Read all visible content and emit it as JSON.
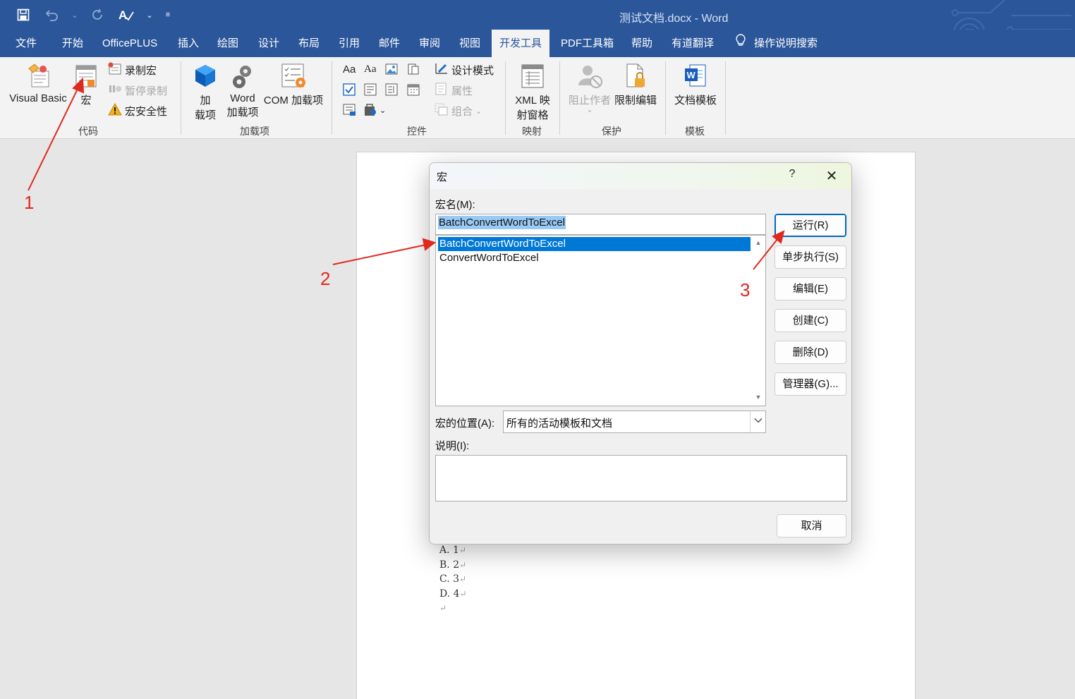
{
  "window": {
    "title": "测试文档.docx  -  Word"
  },
  "qat": {
    "icons": [
      "save-icon",
      "undo-icon",
      "redo-icon",
      "spellcheck-icon",
      "customize-icon"
    ]
  },
  "tabs": [
    {
      "label": "文件",
      "active": false
    },
    {
      "label": "开始",
      "active": false
    },
    {
      "label": "OfficePLUS",
      "active": false
    },
    {
      "label": "插入",
      "active": false
    },
    {
      "label": "绘图",
      "active": false
    },
    {
      "label": "设计",
      "active": false
    },
    {
      "label": "布局",
      "active": false
    },
    {
      "label": "引用",
      "active": false
    },
    {
      "label": "邮件",
      "active": false
    },
    {
      "label": "审阅",
      "active": false
    },
    {
      "label": "视图",
      "active": false
    },
    {
      "label": "开发工具",
      "active": true
    },
    {
      "label": "PDF工具箱",
      "active": false
    },
    {
      "label": "帮助",
      "active": false
    },
    {
      "label": "有道翻译",
      "active": false
    },
    {
      "label": "操作说明搜索",
      "active": false
    }
  ],
  "ribbon": {
    "code": {
      "label": "代码",
      "visual_basic": "Visual Basic",
      "macros": "宏",
      "record_macro": "录制宏",
      "pause_recording": "暂停录制",
      "macro_security": "宏安全性"
    },
    "addins": {
      "label": "加载项",
      "addins_line1": "加",
      "addins_line2": "载项",
      "word_addins_line1": "Word",
      "word_addins_line2": "加载项",
      "com_addins": "COM 加载项"
    },
    "controls": {
      "label": "控件",
      "design_mode": "设计模式",
      "properties": "属性",
      "group": "组合"
    },
    "mapping": {
      "label": "映射",
      "xml_line1": "XML 映",
      "xml_line2": "射窗格"
    },
    "protect": {
      "label": "保护",
      "block_authors": "阻止作者",
      "restrict_editing": "限制编辑"
    },
    "templates": {
      "label": "模板",
      "document_template": "文档模板"
    }
  },
  "document": {
    "lines": [
      "A. 1",
      "B. 2",
      "C. 3",
      "D. 4"
    ],
    "return_mark": "↵"
  },
  "dialog": {
    "title": "宏",
    "help": "?",
    "close": "✕",
    "macro_name_label": "宏名(M):",
    "macro_name_value": "BatchConvertWordToExcel",
    "macro_list": [
      "BatchConvertWordToExcel",
      "ConvertWordToExcel"
    ],
    "selected_index": 0,
    "location_label": "宏的位置(A):",
    "location_value": "所有的活动模板和文档",
    "description_label": "说明(I):",
    "description_value": "",
    "buttons": {
      "run": "运行(R)",
      "step_into": "单步执行(S)",
      "edit": "编辑(E)",
      "create": "创建(C)",
      "delete": "删除(D)",
      "organizer": "管理器(G)...",
      "cancel": "取消"
    }
  },
  "annotations": {
    "one": "1",
    "two": "2",
    "three": "3",
    "color": "#e0291e"
  },
  "colors": {
    "titlebar": "#2b579a",
    "selection": "#0078d7"
  }
}
